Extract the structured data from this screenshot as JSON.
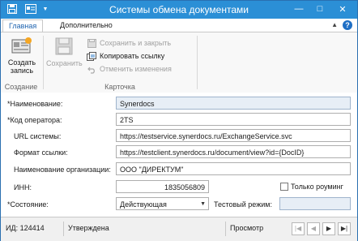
{
  "window": {
    "title": "Системы обмена документами",
    "minimize": "—",
    "maximize": "□",
    "close": "✕"
  },
  "ribbon": {
    "tabs": [
      "Главная",
      "Дополнительно"
    ],
    "create_group": {
      "button_label_line1": "Создать",
      "button_label_line2": "запись",
      "group_label": "Создание"
    },
    "card_group": {
      "save_label": "Сохранить",
      "save_close_label": "Сохранить и закрыть",
      "copy_link_label": "Копировать ссылку",
      "undo_label": "Отменить изменения",
      "group_label": "Карточка"
    },
    "help": "?"
  },
  "form": {
    "name_label": "*Наименование:",
    "name_value": "Synerdocs",
    "operator_code_label": "*Код оператора:",
    "operator_code_value": "2TS",
    "url_label": "URL системы:",
    "url_value": "https://testservice.synerdocs.ru/ExchangeService.svc",
    "link_format_label": "Формат ссылки:",
    "link_format_value": "https://testclient.synerdocs.ru/document/view?id={DocID}",
    "org_name_label": "Наименование организации:",
    "org_name_value": "ООО \"ДИРЕКТУМ\"",
    "inn_label": "ИНН:",
    "inn_value": "1835056809",
    "roaming_only_label": "Только роуминг",
    "roaming_only_checked": false,
    "state_label": "*Состояние:",
    "state_value": "Действующая",
    "test_mode_label": "Тестовый режим:",
    "test_mode_value": ""
  },
  "statusbar": {
    "id_text": "ИД: 124414",
    "approval_state": "Утверждена",
    "mode": "Просмотр",
    "nav_first": "|◀",
    "nav_prev": "◀",
    "nav_next": "▶",
    "nav_last": "▶|"
  }
}
